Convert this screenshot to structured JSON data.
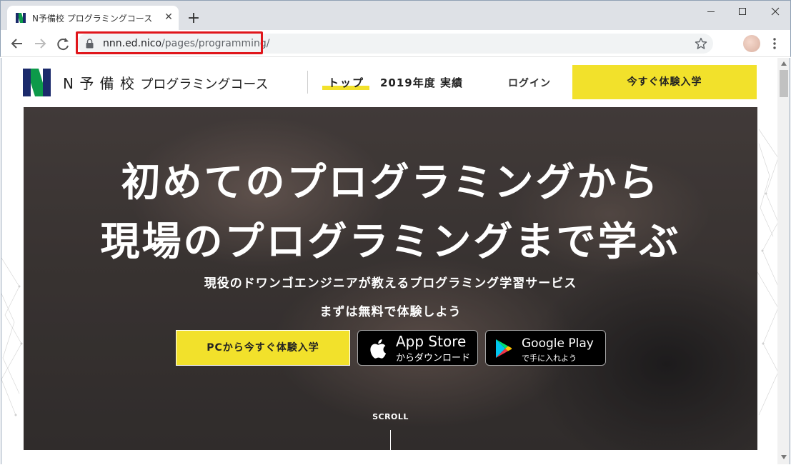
{
  "browser": {
    "tab_title": "N予備校 プログラミングコース",
    "url_host": "nnn.ed.nico",
    "url_path": "/pages/programming/"
  },
  "header": {
    "logo_brand": "N 予 備 校",
    "logo_sub": "プログラミングコース",
    "nav_top": "トップ",
    "nav_results": "2019年度 実績",
    "nav_login": "ログイン",
    "cta": "今すぐ体験入学"
  },
  "hero": {
    "title_line1": "初めてのプログラミングから",
    "title_line2": "現場のプログラミングまで学ぶ",
    "subtitle": "現役のドワンゴエンジニアが教えるプログラミング学習サービス",
    "subtitle2": "まずは無料で体験しよう",
    "cta": "PCから今すぐ体験入学",
    "app_store_main": "App Store",
    "app_store_sub": "からダウンロード",
    "google_play_main": "Google Play",
    "google_play_sub": "で手に入れよう",
    "scroll_label": "SCROLL"
  },
  "colors": {
    "accent_yellow": "#f2e12b",
    "logo_navy": "#1b2a6b",
    "logo_green": "#0d9a4a",
    "highlight_red": "#e0161b"
  }
}
